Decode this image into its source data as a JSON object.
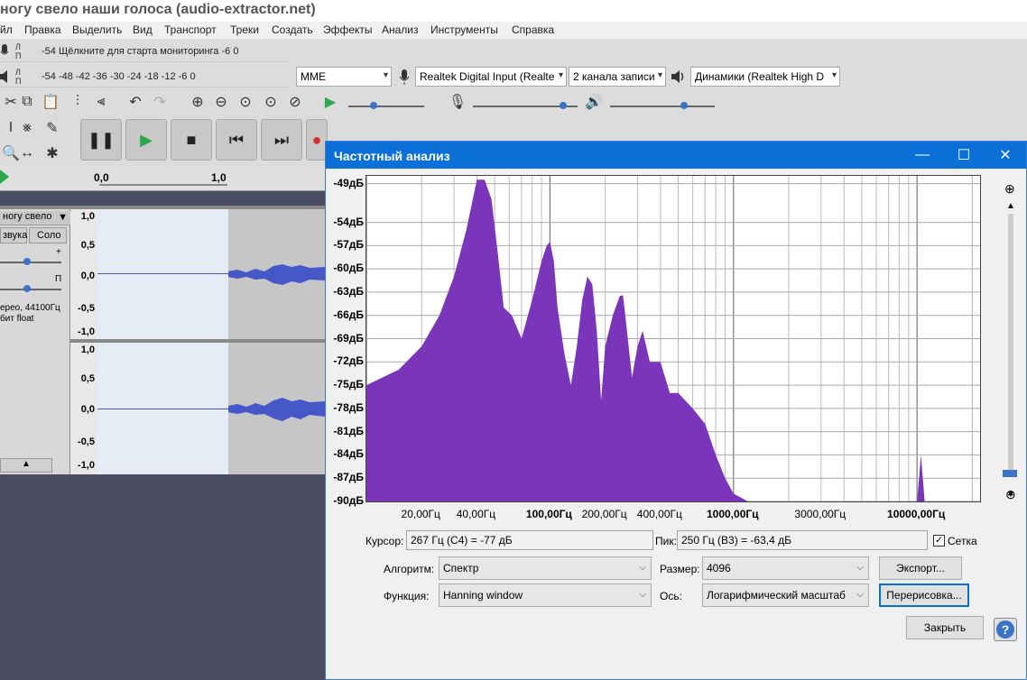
{
  "app": {
    "title": "ногу свело наши голоса (audio-extractor.net)"
  },
  "menu": [
    "йл",
    "Правка",
    "Выделить",
    "Вид",
    "Транспорт",
    "Треки",
    "Создать",
    "Эффекты",
    "Анализ",
    "Инструменты",
    "Справка"
  ],
  "meters": {
    "record_lr": [
      "Л",
      "П"
    ],
    "record_ticks": "-54   Щёлкните для старта мониторинга   -6    0",
    "play_lr": [
      "Л",
      "П"
    ],
    "play_ticks": "-54  -48  -42  -36  -30  -24  -18  -12   -6    0"
  },
  "devices": {
    "host": "MME",
    "input": "Realtek Digital Input (Realte",
    "channels": "2  канала записи",
    "output": "Динамики (Realtek High D"
  },
  "timeline": {
    "t0": "0,0",
    "t1": "1,0"
  },
  "track": {
    "name": "ногу свело",
    "mute_label": "звука",
    "solo_label": "Соло",
    "gain_plus": "+",
    "pan_r": "П",
    "info1": "ереo, 44100Гц",
    "info2": "бит float",
    "scale_top": [
      "1,0",
      "0,5",
      "0,0",
      "-0,5",
      "-1,0"
    ],
    "scale_bottom": [
      "1,0",
      "0,5",
      "0,0",
      "-0,5",
      "-1,0"
    ]
  },
  "dialog": {
    "title": "Частотный анализ",
    "minimize": "—",
    "maximize": "☐",
    "close": "✕",
    "y_labels": [
      "-49дБ",
      "-54дБ",
      "-57дБ",
      "-60дБ",
      "-63дБ",
      "-66дБ",
      "-69дБ",
      "-72дБ",
      "-75дБ",
      "-78дБ",
      "-81дБ",
      "-84дБ",
      "-87дБ",
      "-90дБ"
    ],
    "x_labels": [
      {
        "text": "20,00Гц",
        "bold": false
      },
      {
        "text": "40,00Гц",
        "bold": false
      },
      {
        "text": "100,00Гц",
        "bold": true
      },
      {
        "text": "200,00Гц",
        "bold": false
      },
      {
        "text": "400,00Гц",
        "bold": false
      },
      {
        "text": "1000,00Гц",
        "bold": true
      },
      {
        "text": "3000,00Гц",
        "bold": false
      },
      {
        "text": "10000,00Гц",
        "bold": true
      }
    ],
    "cursor_label": "Курсор:",
    "cursor_value": "267 Гц (C4) = -77 дБ",
    "peak_label": "Пик:",
    "peak_value": "250 Гц (B3) = -63,4 дБ",
    "grid_label": "Сетка",
    "grid_checked": true,
    "algorithm_label": "Алгоритм:",
    "algorithm_value": "Спектр",
    "size_label": "Размер:",
    "size_value": "4096",
    "export_label": "Экспорт...",
    "function_label": "Функция:",
    "function_value": "Hanning window",
    "axis_label": "Ось:",
    "axis_value": "Логарифмический масштаб",
    "replot_label": "Перерисовка...",
    "close_label": "Закрыть",
    "help_label": "?"
  },
  "colors": {
    "spectrum": "#7b35bb",
    "title_bar": "#0a6fd6",
    "waveform": "#4657c8"
  },
  "chart_data": {
    "type": "area",
    "title": "",
    "xlabel": "",
    "ylabel": "",
    "xscale": "log",
    "xlim": [
      10,
      22050
    ],
    "ylim": [
      -90,
      -48
    ],
    "grid": true,
    "series": [
      {
        "x": [
          10,
          15,
          20,
          25,
          30,
          35,
          38,
          40,
          44,
          48,
          52,
          56,
          62,
          70,
          80,
          90,
          96,
          100,
          105,
          110,
          120,
          130,
          140,
          150,
          160,
          170,
          180,
          190,
          200,
          220,
          240,
          250,
          260,
          280,
          300,
          320,
          350,
          400,
          450,
          500,
          600,
          700,
          800,
          900,
          1000,
          1200,
          1500,
          2000,
          5000,
          10000,
          10500,
          11000,
          20000
        ],
        "values": [
          -75,
          -73,
          -70,
          -66,
          -61,
          -55,
          -51,
          -48.5,
          -48.5,
          -51,
          -58,
          -65,
          -66,
          -69,
          -64,
          -59,
          -57,
          -56.5,
          -59,
          -65,
          -71,
          -75,
          -70,
          -64,
          -61,
          -62,
          -68,
          -77,
          -70,
          -66,
          -63.5,
          -63.4,
          -67,
          -74,
          -70,
          -68,
          -72,
          -72,
          -76,
          -76,
          -78,
          -80,
          -84,
          -87,
          -89,
          -90,
          -90,
          -90,
          -90,
          -90,
          -84,
          -90,
          -90
        ]
      }
    ]
  }
}
